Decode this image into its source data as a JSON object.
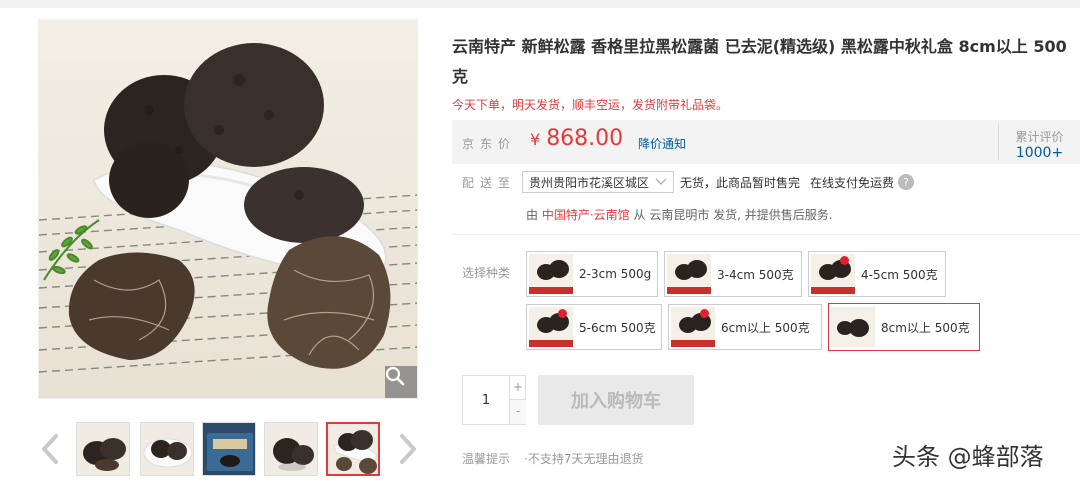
{
  "product": {
    "title": "云南特产 新鲜松露 香格里拉黑松露菌 已去泥(精选级) 黑松露中秋礼盒 8cm以上 500克",
    "promo": "今天下单，明天发货，顺丰空运，发货附带礼品袋。"
  },
  "price": {
    "label": "京东价",
    "symbol": "¥",
    "value": "868.00",
    "notify": "降价通知",
    "rating_label": "累计评价",
    "rating_count": "1000+"
  },
  "delivery": {
    "label": "配送至",
    "address": "贵州贵阳市花溪区城区",
    "stock": "无货，此商品暂时售完",
    "freeship": "在线支付免运费",
    "seller_prefix": "由",
    "store": "中国特产·云南馆",
    "seller_suffix": "从 云南昆明市 发货, 并提供售后服务."
  },
  "variants": {
    "label": "选择种类",
    "items": [
      {
        "label": "2-3cm 500g",
        "selected": false
      },
      {
        "label": "3-4cm 500克",
        "selected": false
      },
      {
        "label": "4-5cm 500克",
        "selected": false
      },
      {
        "label": "5-6cm 500克",
        "selected": false
      },
      {
        "label": "6cm以上 500克",
        "selected": false
      },
      {
        "label": "8cm以上 500克",
        "selected": true
      }
    ]
  },
  "purchase": {
    "quantity": "1",
    "plus": "+",
    "minus": "-",
    "cart_label": "加入购物车"
  },
  "tips": {
    "label": "温馨提示",
    "item": "·不支持7天无理由退货"
  },
  "watermark": "头条 @蜂部落",
  "colors": {
    "accent_red": "#e4393c",
    "link_blue": "#005aa0"
  },
  "icons": [
    "zoom-icon",
    "chevron-left-icon",
    "chevron-right-icon",
    "chevron-down-icon",
    "help-icon"
  ]
}
